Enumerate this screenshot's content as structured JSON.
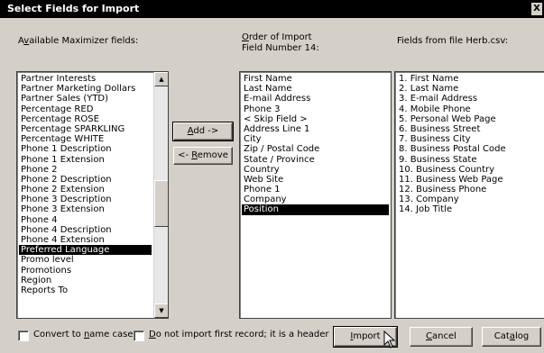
{
  "window": {
    "title": "Select Fields for Import",
    "close_glyph": "X"
  },
  "labels": {
    "available_prefix": "A",
    "available_accel": "v",
    "available_rest": "ailable Maximizer fields:",
    "order_accel": "O",
    "order_rest": "rder of Import",
    "field_number": "Field Number 14:",
    "fields_from_file": "Fields from file Herb.csv:"
  },
  "available_fields": [
    "Partner Interests",
    "Partner Marketing Dollars",
    "Partner Sales (YTD)",
    "Percentage RED",
    "Percentage ROSE",
    "Percentage SPARKLING",
    "Percentage WHITE",
    "Phone 1 Description",
    "Phone 1 Extension",
    "Phone 2",
    "Phone 2 Description",
    "Phone 2 Extension",
    "Phone 3 Description",
    "Phone 3 Extension",
    "Phone 4",
    "Phone 4 Description",
    "Phone 4 Extension",
    "Preferred Language",
    "Promo level",
    "Promotions",
    "Region",
    "Reports To"
  ],
  "available_selected_index": 17,
  "order_of_import": [
    "First Name",
    "Last Name",
    "E-mail Address",
    "Phone 3",
    "< Skip Field >",
    "Address Line 1",
    "City",
    "Zip / Postal Code",
    "State / Province",
    "Country",
    "Web Site",
    "Phone 1",
    "Company",
    "Position"
  ],
  "order_selected_index": 13,
  "file_fields": [
    "1. First Name",
    "2. Last Name",
    "3. E-mail Address",
    "4. Mobile Phone",
    "5. Personal Web Page",
    "6. Business Street",
    "7. Business City",
    "8. Business Postal Code",
    "9. Business State",
    "10. Business Country",
    "11. Business Web Page",
    "12. Business Phone",
    "13. Company",
    "14. Job Title"
  ],
  "buttons": {
    "add_accel": "A",
    "add_rest": "dd ->",
    "remove_prefix": "<- ",
    "remove_accel": "R",
    "remove_rest": "emove",
    "import_accel": "I",
    "import_rest": "mport",
    "cancel_accel": "C",
    "cancel_rest": "ancel",
    "catalog_prefix": "Cat",
    "catalog_accel": "a",
    "catalog_rest": "log"
  },
  "checkboxes": {
    "convert_prefix": "Convert to ",
    "convert_accel": "n",
    "convert_rest": "ame case",
    "convert_checked": false,
    "noheader_accel": "D",
    "noheader_rest": "o not import first record; it is a header",
    "noheader_checked": false
  },
  "scroll_arrows": {
    "up": "▲",
    "down": "▼"
  }
}
